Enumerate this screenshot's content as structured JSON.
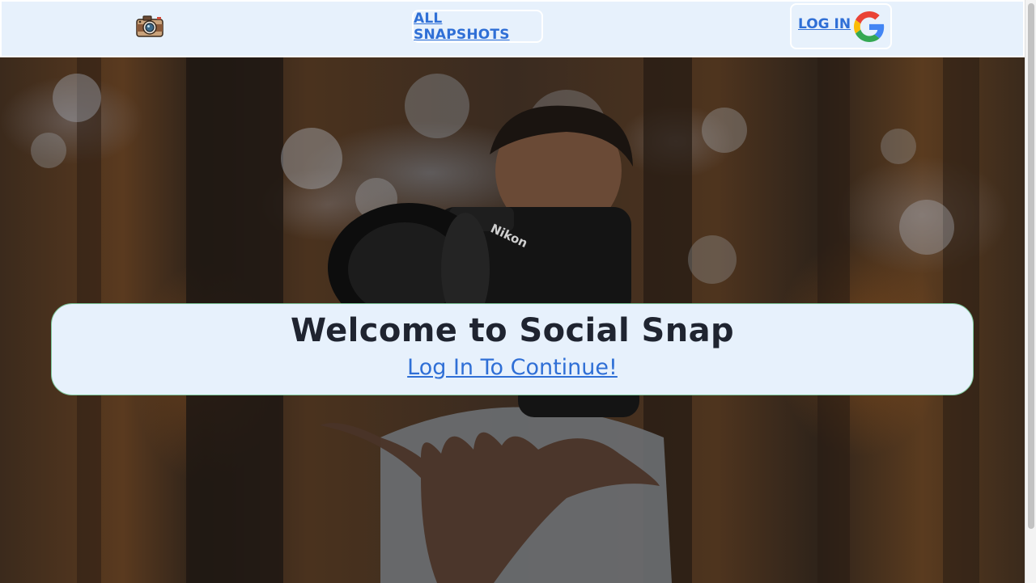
{
  "navbar": {
    "logo_icon": "camera-icon",
    "snapshots_label": "ALL SNAPSHOTS",
    "login_label": "LOG IN",
    "login_icon": "google-icon"
  },
  "hero": {
    "image": "photographer-tossing-camera-in-forest"
  },
  "welcome": {
    "title": "Welcome to Social Snap",
    "cta_label": "Log In To Continue!"
  },
  "colors": {
    "nav_bg": "#e7f1fc",
    "link": "#2f6fd6",
    "text": "#1f2430",
    "card_border": "#7ec79a"
  }
}
